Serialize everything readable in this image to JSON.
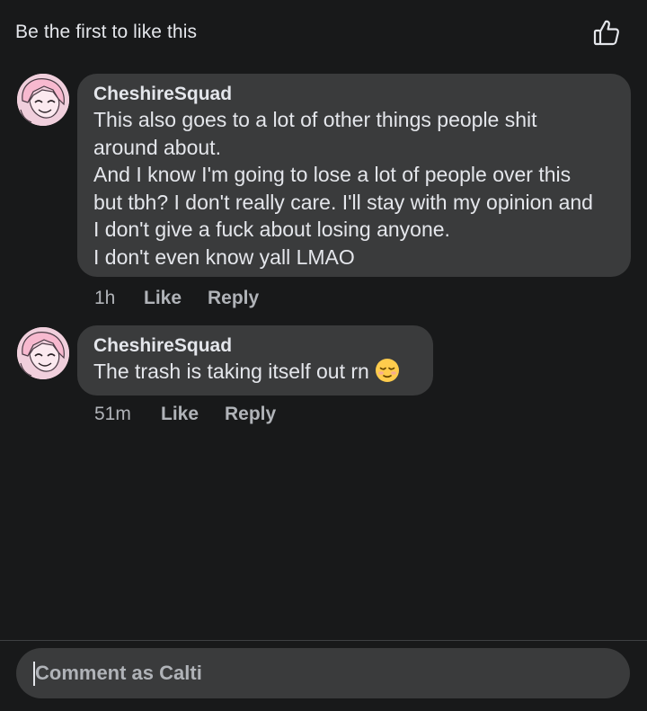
{
  "header": {
    "likes_text": "Be the first to like this",
    "like_icon": "thumbs-up-outline-icon"
  },
  "comments": [
    {
      "author": "CheshireSquad",
      "lines": [
        "This also goes to a lot of other things people shit",
        "around about.",
        "And I know I'm going to lose a lot of people over this",
        "but tbh? I don't really care. I'll stay with my opinion and",
        "I don't give a fuck about losing anyone.",
        "I don't even know yall LMAO"
      ],
      "time": "1h",
      "like_label": "Like",
      "reply_label": "Reply"
    },
    {
      "author": "CheshireSquad",
      "lines": [
        "The trash is taking itself out rn"
      ],
      "emoji": "relieved-face-emoji",
      "time": "51m",
      "like_label": "Like",
      "reply_label": "Reply"
    }
  ],
  "composer": {
    "placeholder": "Comment as Calti"
  },
  "colors": {
    "background": "#18191a",
    "bubble": "#3a3b3c",
    "text": "#e4e6eb",
    "secondary_text": "#b0b3b8"
  }
}
